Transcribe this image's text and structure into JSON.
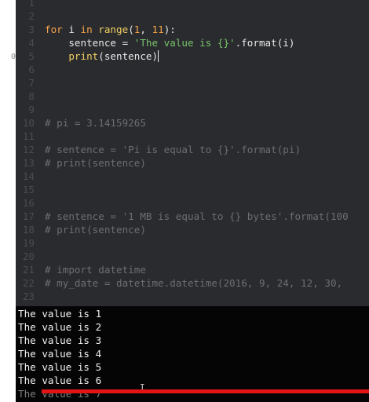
{
  "editor": {
    "lines": [
      {
        "n": "1",
        "tokens": []
      },
      {
        "n": "2",
        "tokens": []
      },
      {
        "n": "3",
        "tokens": [
          {
            "t": "kw",
            "v": "for "
          },
          {
            "t": "plain",
            "v": "i "
          },
          {
            "t": "kw",
            "v": "in "
          },
          {
            "t": "fn",
            "v": "range"
          },
          {
            "t": "plain",
            "v": "("
          },
          {
            "t": "num",
            "v": "1"
          },
          {
            "t": "plain",
            "v": ", "
          },
          {
            "t": "num",
            "v": "11"
          },
          {
            "t": "plain",
            "v": "):"
          }
        ]
      },
      {
        "n": "4",
        "tokens": [
          {
            "t": "plain",
            "v": "    sentence = "
          },
          {
            "t": "str",
            "v": "'The value is {}'"
          },
          {
            "t": "plain",
            "v": ".format(i)"
          }
        ]
      },
      {
        "n": "5",
        "mark": "0",
        "cursor": true,
        "tokens": [
          {
            "t": "plain",
            "v": "    "
          },
          {
            "t": "fn",
            "v": "print"
          },
          {
            "t": "plain",
            "v": "(sentence)"
          }
        ]
      },
      {
        "n": "6",
        "tokens": []
      },
      {
        "n": "7",
        "tokens": []
      },
      {
        "n": "8",
        "tokens": []
      },
      {
        "n": "9",
        "tokens": []
      },
      {
        "n": "10",
        "tokens": [
          {
            "t": "cm",
            "v": "# pi = 3.14159265"
          }
        ]
      },
      {
        "n": "11",
        "tokens": []
      },
      {
        "n": "12",
        "tokens": [
          {
            "t": "cm",
            "v": "# sentence = 'Pi is equal to {}'.format(pi)"
          }
        ]
      },
      {
        "n": "13",
        "tokens": [
          {
            "t": "cm",
            "v": "# print(sentence)"
          }
        ]
      },
      {
        "n": "14",
        "tokens": []
      },
      {
        "n": "15",
        "tokens": []
      },
      {
        "n": "16",
        "tokens": []
      },
      {
        "n": "17",
        "tokens": [
          {
            "t": "cm",
            "v": "# sentence = '1 MB is equal to {} bytes'.format(100"
          }
        ]
      },
      {
        "n": "18",
        "tokens": [
          {
            "t": "cm",
            "v": "# print(sentence)"
          }
        ]
      },
      {
        "n": "19",
        "tokens": []
      },
      {
        "n": "20",
        "tokens": []
      },
      {
        "n": "21",
        "tokens": [
          {
            "t": "cm",
            "v": "# import datetime"
          }
        ]
      },
      {
        "n": "22",
        "tokens": [
          {
            "t": "cm",
            "v": "# my_date = datetime.datetime(2016, 9, 24, 12, 30,"
          }
        ]
      },
      {
        "n": "23",
        "tokens": []
      }
    ]
  },
  "output": {
    "lines": [
      "The value is 1",
      "The value is 2",
      "The value is 3",
      "The value is 4",
      "The value is 5",
      "The value is 6",
      "The value is 7"
    ],
    "faded_index": 6
  },
  "colors": {
    "editor_bg": "#2a2b2e",
    "keyword": "#f7a54a",
    "string": "#78c36b",
    "function": "#f0d062",
    "comment": "#6b6e74",
    "output_bg": "#050505",
    "highlight_bar": "#e41414"
  }
}
